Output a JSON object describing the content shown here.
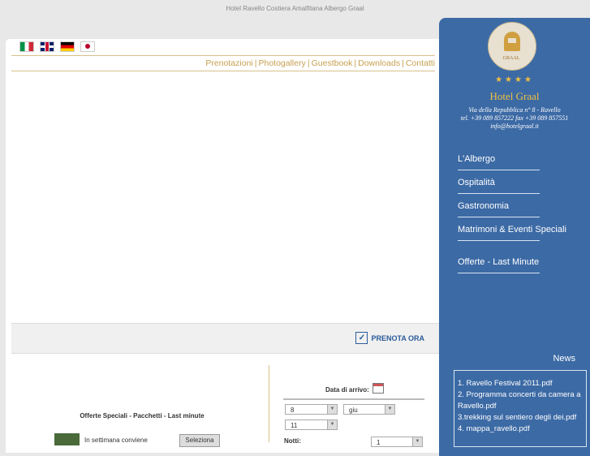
{
  "header": {
    "top_text": "Hotel Ravello Costiera Amalfitana Albergo Graal"
  },
  "languages": [
    {
      "icon": "flag-it-icon"
    },
    {
      "icon": "flag-gb-icon"
    },
    {
      "icon": "flag-de-icon"
    },
    {
      "icon": "flag-jp-icon"
    }
  ],
  "nav": {
    "items": [
      "Prenotazioni",
      "Photogallery",
      "Guestbook",
      "Downloads",
      "Contatti"
    ],
    "separator": "|"
  },
  "booking": {
    "prenota_label": "PRENOTA ORA",
    "date_label": "Data di arrivo:",
    "day": "8",
    "month": "giu",
    "year": "11",
    "nights_label": "Notti:",
    "nights": "1"
  },
  "offers": {
    "title": "Offerte Speciali - Pacchetti - Last minute",
    "item_text": "In settimana conviene",
    "select_label": "Seleziona"
  },
  "sidebar": {
    "logo_text": "GRAAL",
    "stars": "★★★★",
    "hotel_name": "Hotel Graal",
    "address": "Via della Repubblica n° 8 - Ravello",
    "phone": "tel. +39 089 857222 fax +39 089 857551",
    "email": "info@hotelgraal.it",
    "menu": [
      "L'Albergo",
      "Ospitalità",
      "Gastronomia",
      "Matrimoni & Eventi Speciali",
      "Offerte - Last Minute"
    ],
    "news_title": "News",
    "news": [
      "1. Ravello Festival 2011.pdf",
      "2. Programma concerti da camera a Ravello.pdf",
      "3.trekking sul sentiero degli dei.pdf",
      "4. mappa_ravello.pdf"
    ]
  },
  "colors": {
    "sidebar": "#3c6aa5",
    "accent": "#c8a050",
    "gold": "#f0c040"
  }
}
